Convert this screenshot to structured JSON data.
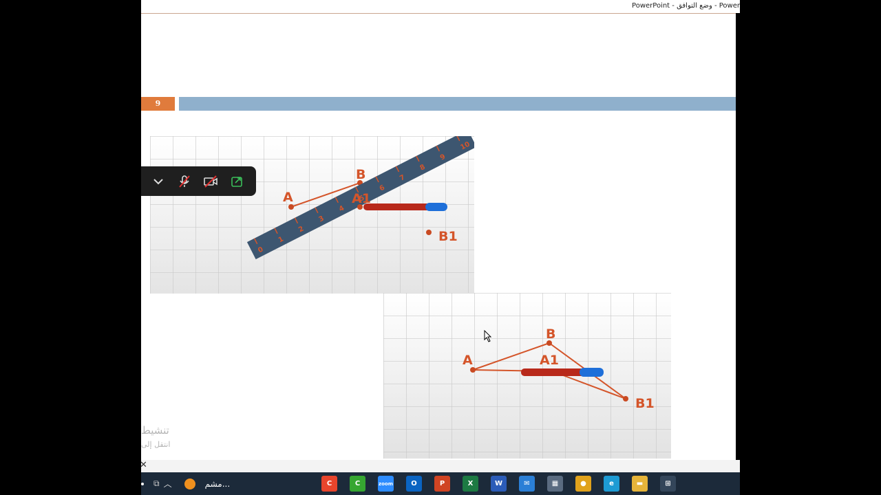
{
  "window": {
    "title": "PowerPoint - وضع التوافق -  Power"
  },
  "slide": {
    "number": "9",
    "accent": "#e07b3c",
    "bar_color": "#8fb0cc"
  },
  "figure_top": {
    "labels": {
      "a": "A",
      "b": "B",
      "a1": "A1",
      "b1": "B1"
    },
    "ruler_ticks": [
      "0",
      "1",
      "2",
      "3",
      "4",
      "5",
      "6",
      "7",
      "8",
      "9",
      "10"
    ]
  },
  "figure_bottom": {
    "labels": {
      "a": "A",
      "b": "B",
      "a1": "A1",
      "b1": "B1"
    }
  },
  "zoom_controls": {
    "icons": [
      "chevron-down-icon",
      "mic-muted-icon",
      "video-off-icon",
      "share-screen-icon"
    ]
  },
  "watermark": {
    "line1": "تنشيط",
    "line2": "انتقل إلى"
  },
  "taskbar": {
    "tray_text": "مشم...",
    "apps": [
      {
        "name": "camtasia",
        "label": "C",
        "color": "#e8452c"
      },
      {
        "name": "camtasia-recorder",
        "label": "C",
        "color": "#36a631"
      },
      {
        "name": "zoom",
        "label": "zoom",
        "color": "#2d8cff"
      },
      {
        "name": "outlook",
        "label": "O",
        "color": "#0a64c2"
      },
      {
        "name": "powerpoint",
        "label": "P",
        "color": "#d04423"
      },
      {
        "name": "excel",
        "label": "X",
        "color": "#1d7a43"
      },
      {
        "name": "word",
        "label": "W",
        "color": "#2b5cb8"
      },
      {
        "name": "mail",
        "label": "✉",
        "color": "#2b7fd6"
      },
      {
        "name": "store",
        "label": "▦",
        "color": "#5a6b80"
      },
      {
        "name": "chrome",
        "label": "●",
        "color": "#e0a21c"
      },
      {
        "name": "edge",
        "label": "e",
        "color": "#1d9bd4"
      },
      {
        "name": "file-explorer",
        "label": "▬",
        "color": "#e6b43a"
      },
      {
        "name": "task-view",
        "label": "⊞",
        "color": "#34465a"
      }
    ]
  }
}
